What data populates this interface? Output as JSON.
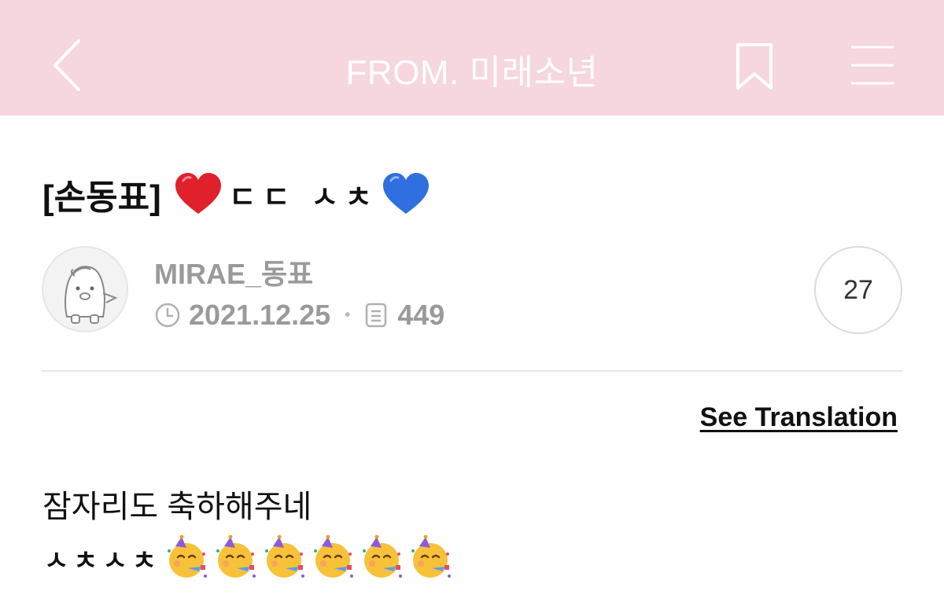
{
  "header": {
    "title": "FROM. 미래소년",
    "back_icon": "chevron-left-icon",
    "bookmark_icon": "bookmark-icon",
    "menu_icon": "hamburger-menu-icon",
    "background": "#f6d7de",
    "text_color": "#ffffff"
  },
  "post": {
    "title_prefix": "[손동표]",
    "title_middle": "ㄷㄷ ㅅㅊ",
    "title_icons": [
      "red-heart-icon",
      "blue-heart-icon"
    ],
    "author": "MIRAE_동표",
    "date": "2021.12.25",
    "views": "449",
    "comment_count": "27",
    "see_translation": "See Translation",
    "body_line1": "잠자리도 축하해주네",
    "body_line2_text": "ㅅㅊㅅㅊ",
    "party_emoji_count": 6
  },
  "colors": {
    "meta_gray": "#9a9a9a",
    "heart_red": "#e0202b",
    "heart_blue": "#2f6fe0"
  }
}
